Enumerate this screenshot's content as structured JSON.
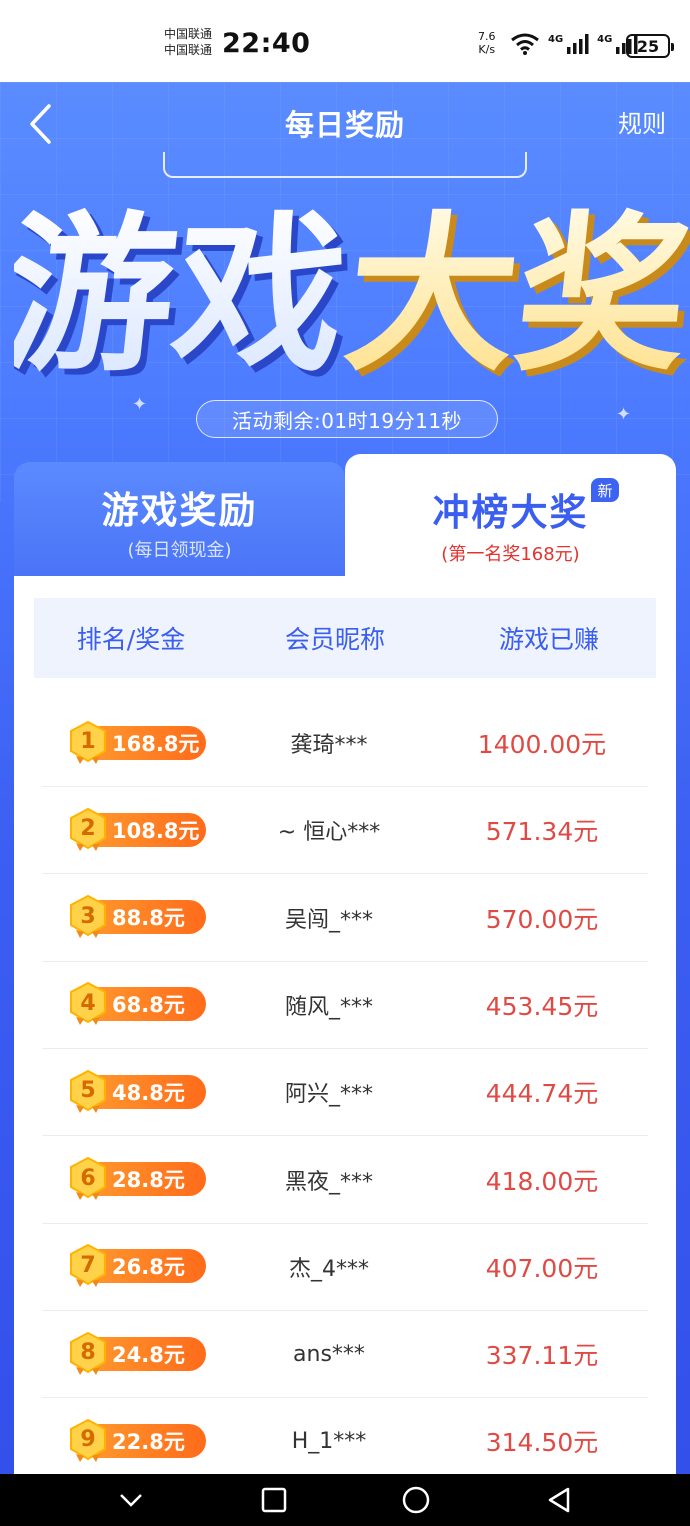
{
  "status_bar": {
    "carrier_1": "中国联通",
    "carrier_2": "中国联通",
    "time": "22:40",
    "net_speed_value": "7.6",
    "net_speed_unit": "K/s",
    "signal_1_label": "4G",
    "signal_2_label": "4G",
    "battery": "25"
  },
  "nav": {
    "title": "每日奖励",
    "rules": "规则"
  },
  "hero": {
    "title_part1": "游戏",
    "title_part2": "大奖",
    "countdown": "活动剩余:01时19分11秒"
  },
  "tabs": [
    {
      "label": "游戏奖励",
      "sub": "(每日领现金)"
    },
    {
      "label": "冲榜大奖",
      "sub": "(第一名奖168元)",
      "badge": "新"
    }
  ],
  "table": {
    "headers": [
      "排名/奖金",
      "会员昵称",
      "游戏已赚"
    ],
    "rows": [
      {
        "rank": "1",
        "prize": "168.8元",
        "name": "龚琦***",
        "earned": "1400.00元"
      },
      {
        "rank": "2",
        "prize": "108.8元",
        "name": "~ 恒心***",
        "earned": "571.34元"
      },
      {
        "rank": "3",
        "prize": "88.8元",
        "name": "吴闯_***",
        "earned": "570.00元"
      },
      {
        "rank": "4",
        "prize": "68.8元",
        "name": "随风_***",
        "earned": "453.45元"
      },
      {
        "rank": "5",
        "prize": "48.8元",
        "name": "阿兴_***",
        "earned": "444.74元"
      },
      {
        "rank": "6",
        "prize": "28.8元",
        "name": "黑夜_***",
        "earned": "418.00元"
      },
      {
        "rank": "7",
        "prize": "26.8元",
        "name": "杰_4***",
        "earned": "407.00元"
      },
      {
        "rank": "8",
        "prize": "24.8元",
        "name": "ans***",
        "earned": "337.11元"
      },
      {
        "rank": "9",
        "prize": "22.8元",
        "name": "H_1***",
        "earned": "314.50元"
      }
    ]
  },
  "colors": {
    "brand_blue": "#3a5ef0",
    "prize_orange": "#ff7a1f",
    "earned_red": "#e04a44"
  }
}
